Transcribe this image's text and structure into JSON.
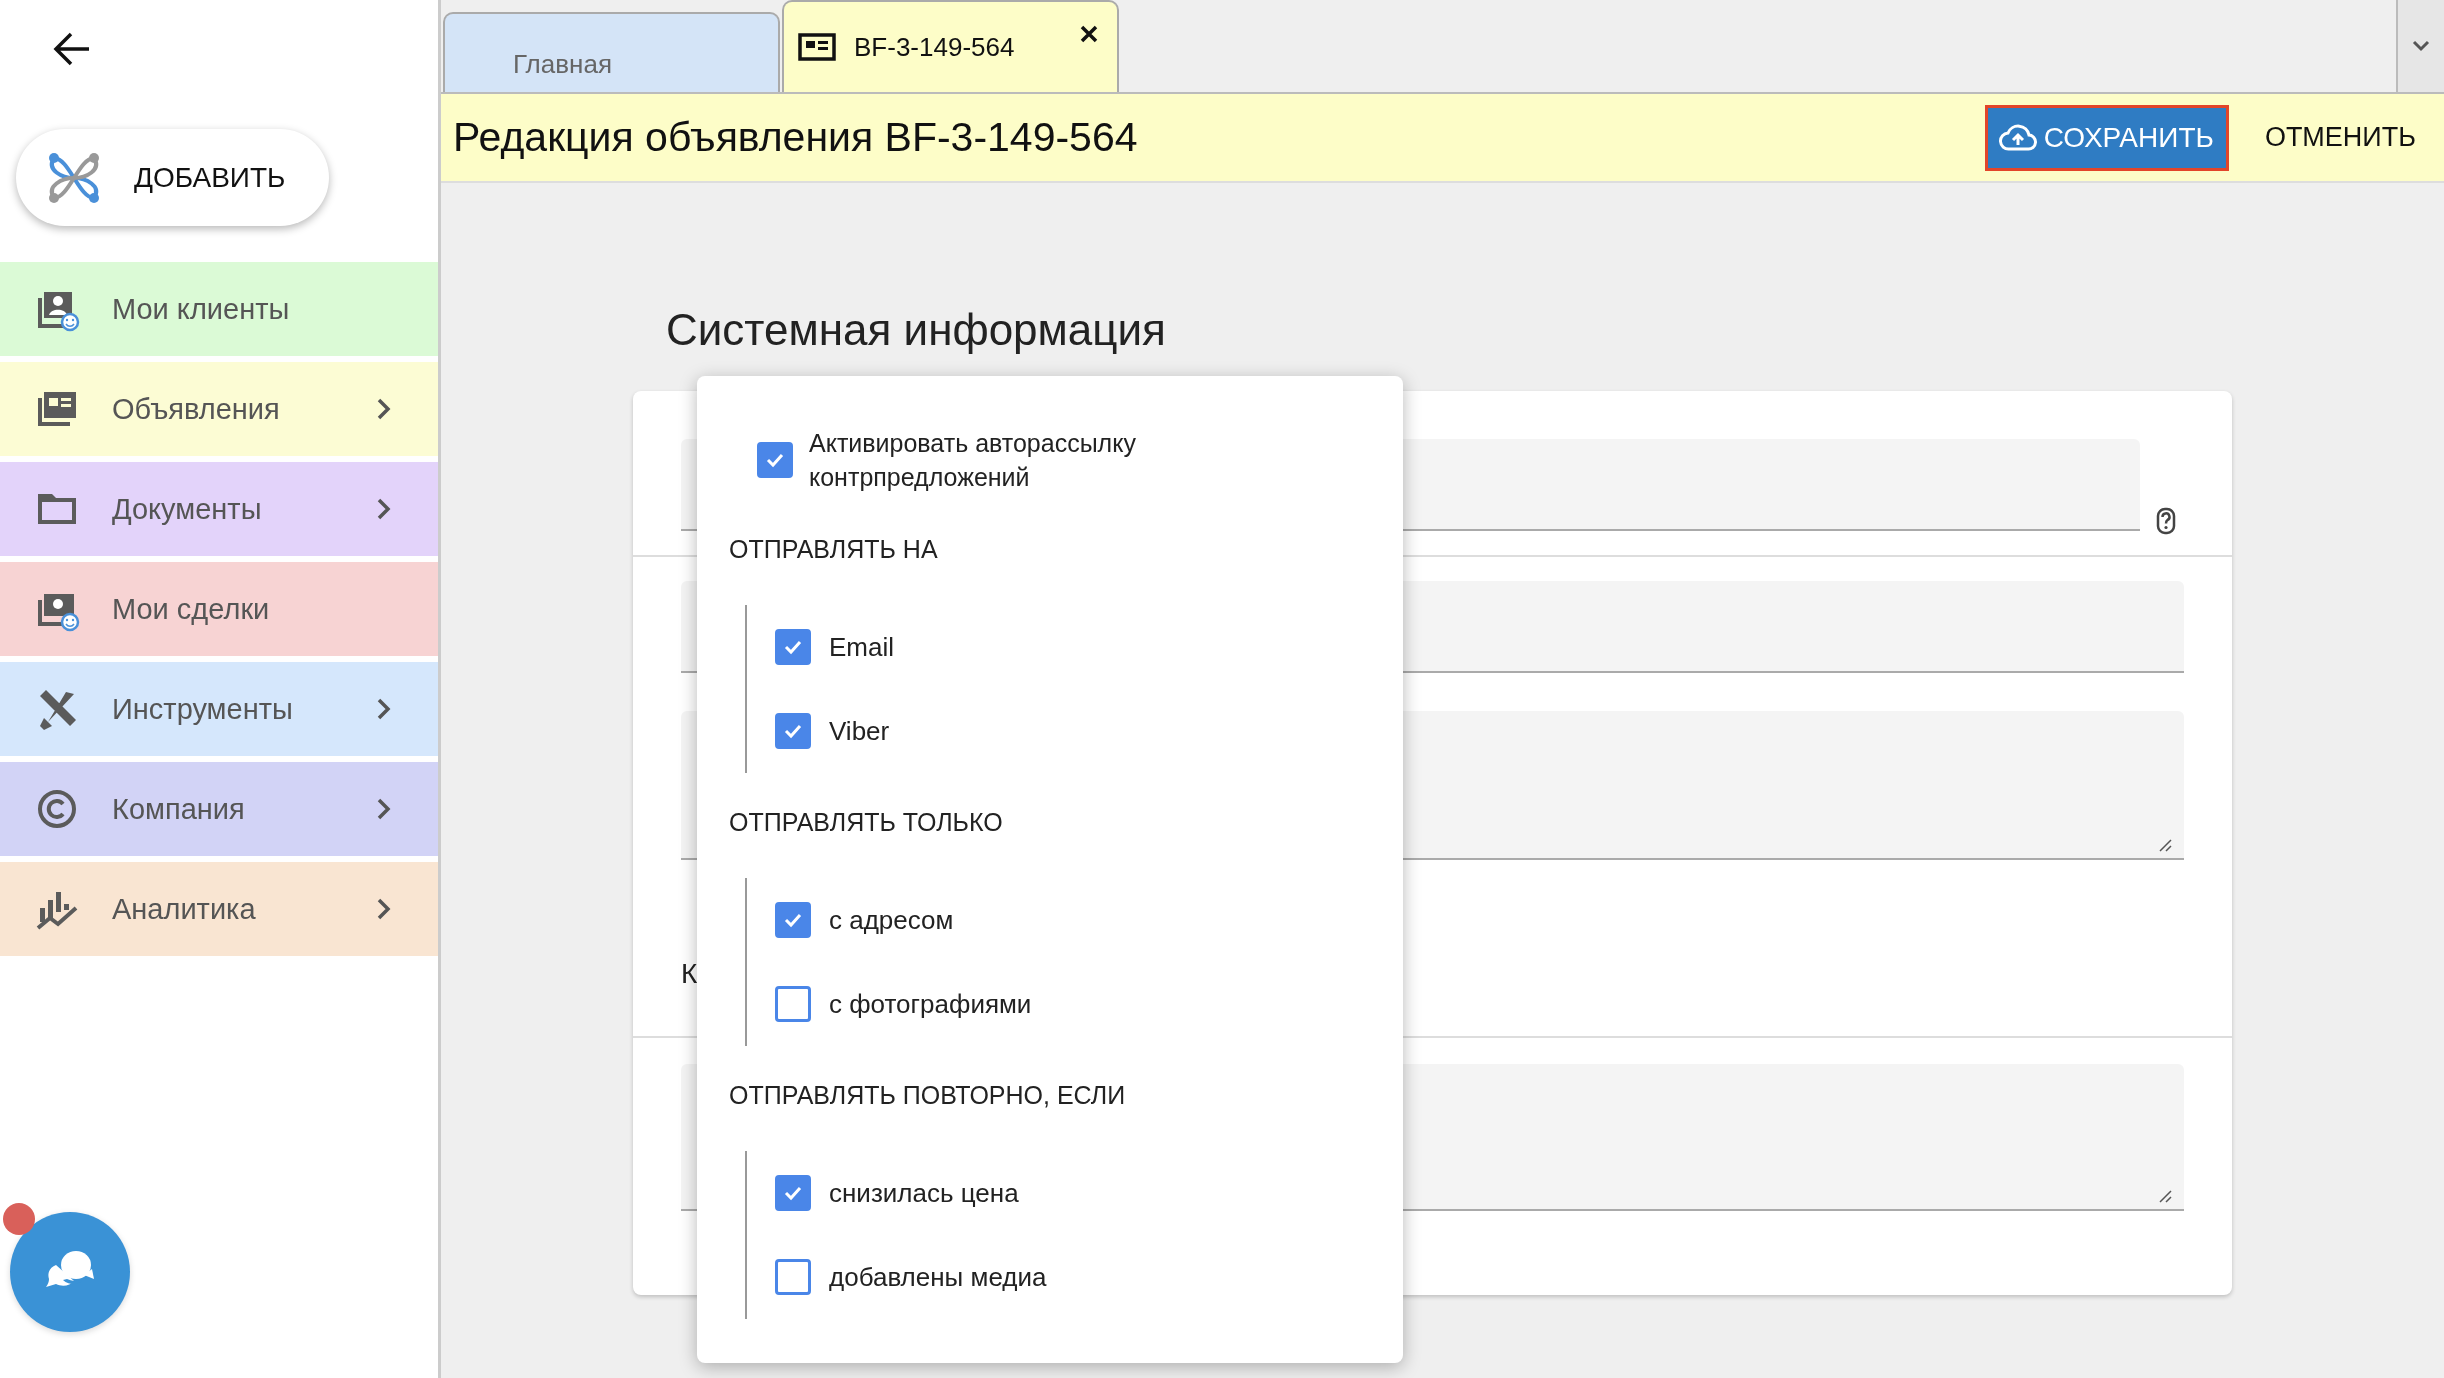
{
  "sidebar": {
    "add_button": "ДОБАВИТЬ",
    "items": [
      {
        "label": "Мои клиенты",
        "color": "#dbfad6",
        "has_submenu": false
      },
      {
        "label": "Объявления",
        "color": "#fcfcd4",
        "has_submenu": true
      },
      {
        "label": "Документы",
        "color": "#e3d3fa",
        "has_submenu": true
      },
      {
        "label": "Мои сделки",
        "color": "#f7d3d3",
        "has_submenu": false
      },
      {
        "label": "Инструменты",
        "color": "#d5e7fc",
        "has_submenu": true
      },
      {
        "label": "Компания",
        "color": "#d2d3f6",
        "has_submenu": true
      },
      {
        "label": "Аналитика",
        "color": "#f9e5d2",
        "has_submenu": true
      }
    ],
    "chat_unread": true
  },
  "tabs": [
    {
      "label": "Главная",
      "selected": false,
      "closable": false
    },
    {
      "label": "BF-3-149-564",
      "selected": true,
      "closable": true
    }
  ],
  "header": {
    "title": "Редакция объявления BF-3-149-564",
    "save_button": "СОХРАНИТЬ",
    "cancel_button": "ОТМЕНИТЬ"
  },
  "section_title": "Системная информация",
  "form": {
    "partial_label": "К"
  },
  "popup": {
    "activate": {
      "label": "Активировать авторассылку контрпредложений",
      "checked": true
    },
    "groups": [
      {
        "title": "ОТПРАВЛЯТЬ НА",
        "options": [
          {
            "label": "Email",
            "checked": true
          },
          {
            "label": "Viber",
            "checked": true
          }
        ]
      },
      {
        "title": "ОТПРАВЛЯТЬ ТОЛЬКО",
        "options": [
          {
            "label": "с адресом",
            "checked": true
          },
          {
            "label": "с фотографиями",
            "checked": false
          }
        ]
      },
      {
        "title": "ОТПРАВЛЯТЬ ПОВТОРНО, ЕСЛИ",
        "options": [
          {
            "label": "снизилась цена",
            "checked": true
          },
          {
            "label": "добавлены медиа",
            "checked": false
          }
        ]
      }
    ]
  }
}
